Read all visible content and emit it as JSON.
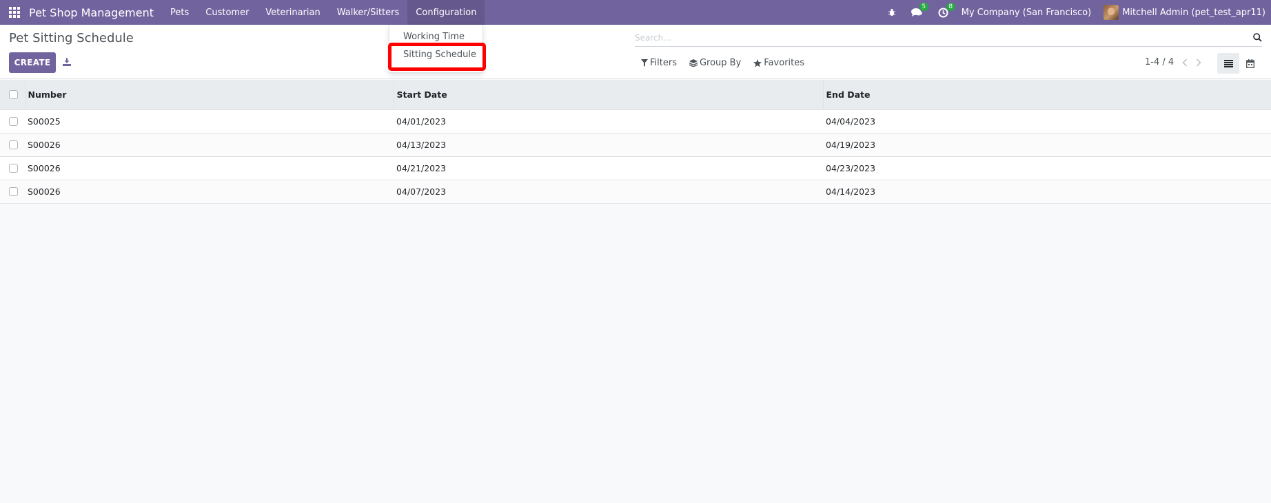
{
  "navbar": {
    "brand": "Pet Shop Management",
    "menu": [
      "Pets",
      "Customer",
      "Veterinarian",
      "Walker/Sitters",
      "Configuration"
    ],
    "active_menu": "Configuration",
    "messages_badge": "5",
    "activities_badge": "8",
    "company": "My Company (San Francisco)",
    "user": "Mitchell Admin (pet_test_apr11)"
  },
  "dropdown": {
    "items": [
      "Working Time",
      "Sitting Schedule"
    ],
    "highlighted": "Sitting Schedule"
  },
  "control_panel": {
    "title": "Pet Sitting Schedule",
    "create_label": "CREATE",
    "search_placeholder": "Search...",
    "filters_label": "Filters",
    "group_by_label": "Group By",
    "favorites_label": "Favorites",
    "pager": "1-4 / 4"
  },
  "table": {
    "columns": [
      "Number",
      "Start Date",
      "End Date"
    ],
    "rows": [
      [
        "S00025",
        "04/01/2023",
        "04/04/2023"
      ],
      [
        "S00026",
        "04/13/2023",
        "04/19/2023"
      ],
      [
        "S00026",
        "04/21/2023",
        "04/23/2023"
      ],
      [
        "S00026",
        "04/07/2023",
        "04/14/2023"
      ]
    ]
  },
  "colors": {
    "navbar": "#71639e",
    "primary_button": "#71639e",
    "badge": "#28a745",
    "highlight": "#ff0000"
  },
  "icons": [
    "apps-icon",
    "bug-icon",
    "chat-icon",
    "clock-icon",
    "download-icon",
    "search-icon",
    "filter-icon",
    "layers-icon",
    "star-icon",
    "chevron-left-icon",
    "chevron-right-icon",
    "list-view-icon",
    "calendar-view-icon"
  ]
}
